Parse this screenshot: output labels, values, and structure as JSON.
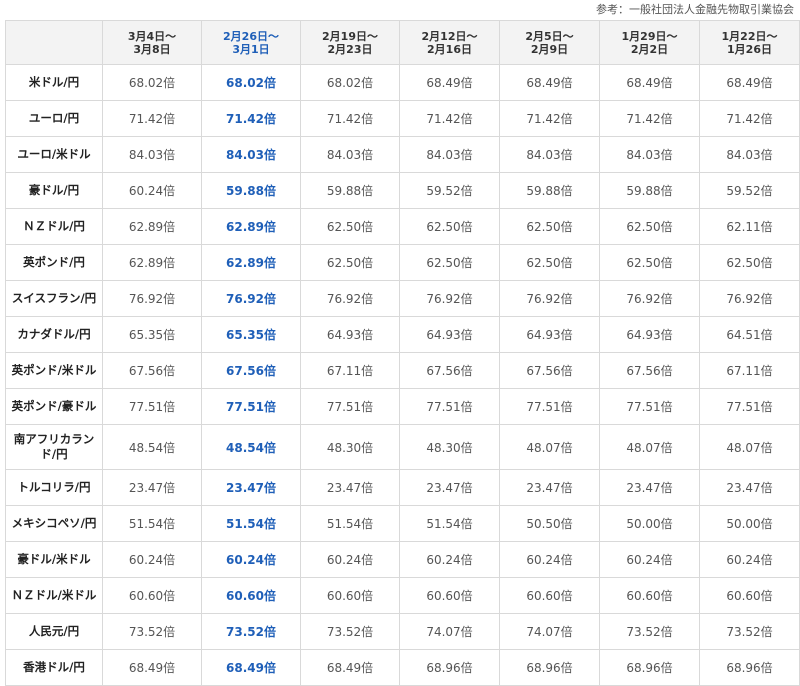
{
  "source_note": "参考：一般社団法人金融先物取引業協会",
  "highlight_color": "#1f5fb8",
  "columns": [
    {
      "line1": "3月4日～",
      "line2": "3月8日",
      "highlight": false
    },
    {
      "line1": "2月26日～",
      "line2": "3月1日",
      "highlight": true
    },
    {
      "line1": "2月19日～",
      "line2": "2月23日",
      "highlight": false
    },
    {
      "line1": "2月12日～",
      "line2": "2月16日",
      "highlight": false
    },
    {
      "line1": "2月5日～",
      "line2": "2月9日",
      "highlight": false
    },
    {
      "line1": "1月29日～",
      "line2": "2月2日",
      "highlight": false
    },
    {
      "line1": "1月22日～",
      "line2": "1月26日",
      "highlight": false
    }
  ],
  "rows": [
    {
      "pair": "米ドル/円",
      "values": [
        "68.02倍",
        "68.02倍",
        "68.02倍",
        "68.49倍",
        "68.49倍",
        "68.49倍",
        "68.49倍"
      ]
    },
    {
      "pair": "ユーロ/円",
      "values": [
        "71.42倍",
        "71.42倍",
        "71.42倍",
        "71.42倍",
        "71.42倍",
        "71.42倍",
        "71.42倍"
      ]
    },
    {
      "pair": "ユーロ/米ドル",
      "values": [
        "84.03倍",
        "84.03倍",
        "84.03倍",
        "84.03倍",
        "84.03倍",
        "84.03倍",
        "84.03倍"
      ]
    },
    {
      "pair": "豪ドル/円",
      "values": [
        "60.24倍",
        "59.88倍",
        "59.88倍",
        "59.52倍",
        "59.88倍",
        "59.88倍",
        "59.52倍"
      ]
    },
    {
      "pair": "ＮＺドル/円",
      "values": [
        "62.89倍",
        "62.89倍",
        "62.50倍",
        "62.50倍",
        "62.50倍",
        "62.50倍",
        "62.11倍"
      ]
    },
    {
      "pair": "英ポンド/円",
      "values": [
        "62.89倍",
        "62.89倍",
        "62.50倍",
        "62.50倍",
        "62.50倍",
        "62.50倍",
        "62.50倍"
      ]
    },
    {
      "pair": "スイスフラン/円",
      "values": [
        "76.92倍",
        "76.92倍",
        "76.92倍",
        "76.92倍",
        "76.92倍",
        "76.92倍",
        "76.92倍"
      ]
    },
    {
      "pair": "カナダドル/円",
      "values": [
        "65.35倍",
        "65.35倍",
        "64.93倍",
        "64.93倍",
        "64.93倍",
        "64.93倍",
        "64.51倍"
      ]
    },
    {
      "pair": "英ポンド/米ドル",
      "values": [
        "67.56倍",
        "67.56倍",
        "67.11倍",
        "67.56倍",
        "67.56倍",
        "67.56倍",
        "67.11倍"
      ]
    },
    {
      "pair": "英ポンド/豪ドル",
      "values": [
        "77.51倍",
        "77.51倍",
        "77.51倍",
        "77.51倍",
        "77.51倍",
        "77.51倍",
        "77.51倍"
      ]
    },
    {
      "pair": "南アフリカランド/円",
      "values": [
        "48.54倍",
        "48.54倍",
        "48.30倍",
        "48.30倍",
        "48.07倍",
        "48.07倍",
        "48.07倍"
      ]
    },
    {
      "pair": "トルコリラ/円",
      "values": [
        "23.47倍",
        "23.47倍",
        "23.47倍",
        "23.47倍",
        "23.47倍",
        "23.47倍",
        "23.47倍"
      ]
    },
    {
      "pair": "メキシコペソ/円",
      "values": [
        "51.54倍",
        "51.54倍",
        "51.54倍",
        "51.54倍",
        "50.50倍",
        "50.00倍",
        "50.00倍"
      ]
    },
    {
      "pair": "豪ドル/米ドル",
      "values": [
        "60.24倍",
        "60.24倍",
        "60.24倍",
        "60.24倍",
        "60.24倍",
        "60.24倍",
        "60.24倍"
      ]
    },
    {
      "pair": "ＮＺドル/米ドル",
      "values": [
        "60.60倍",
        "60.60倍",
        "60.60倍",
        "60.60倍",
        "60.60倍",
        "60.60倍",
        "60.60倍"
      ]
    },
    {
      "pair": "人民元/円",
      "values": [
        "73.52倍",
        "73.52倍",
        "73.52倍",
        "74.07倍",
        "74.07倍",
        "73.52倍",
        "73.52倍"
      ]
    },
    {
      "pair": "香港ドル/円",
      "values": [
        "68.49倍",
        "68.49倍",
        "68.49倍",
        "68.96倍",
        "68.96倍",
        "68.96倍",
        "68.96倍"
      ]
    }
  ]
}
